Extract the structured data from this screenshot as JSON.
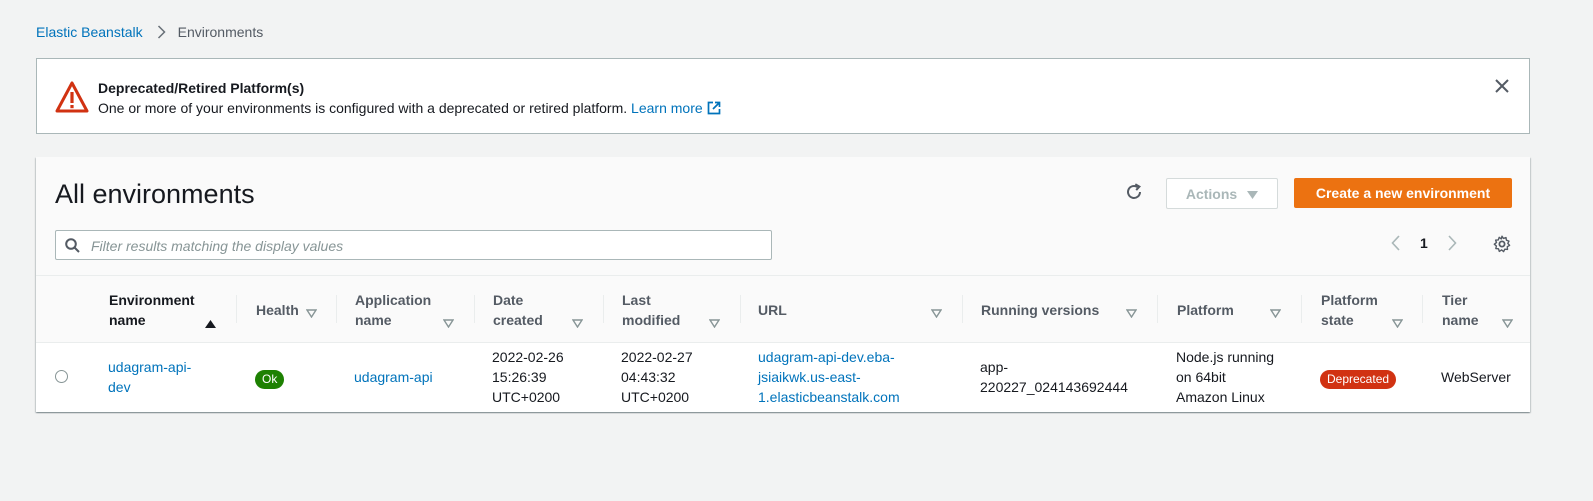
{
  "breadcrumb": {
    "items": [
      "Elastic Beanstalk",
      "Environments"
    ]
  },
  "alert": {
    "title": "Deprecated/Retired Platform(s)",
    "message": "One or more of your environments is configured with a deprecated or retired platform.",
    "link_label": "Learn more",
    "icon": "warning-triangle-icon",
    "color": "#d13212"
  },
  "panel": {
    "title": "All environments",
    "actions_label": "Actions",
    "create_label": "Create a new environment",
    "filter_placeholder": "Filter results matching the display values",
    "page_number": "1"
  },
  "table": {
    "columns": [
      {
        "line1": "Environment",
        "line2": "name",
        "sort": "asc"
      },
      {
        "line1": "Health",
        "line2": "",
        "sort": "filter"
      },
      {
        "line1": "Application",
        "line2": "name",
        "sort": "filter"
      },
      {
        "line1": "Date",
        "line2": "created",
        "sort": "filter"
      },
      {
        "line1": "Last",
        "line2": "modified",
        "sort": "filter"
      },
      {
        "line1": "URL",
        "line2": "",
        "sort": "filter"
      },
      {
        "line1": "Running versions",
        "line2": "",
        "sort": "filter"
      },
      {
        "line1": "Platform",
        "line2": "",
        "sort": "filter"
      },
      {
        "line1": "Platform",
        "line2": "state",
        "sort": "filter"
      },
      {
        "line1": "Tier",
        "line2": "name",
        "sort": "filter"
      }
    ],
    "rows": [
      {
        "env_name": [
          "udagram-api-",
          "dev"
        ],
        "health": "Ok",
        "app_name": "udagram-api",
        "date_created": [
          "2022-02-26",
          "15:26:39",
          "UTC+0200"
        ],
        "last_modified": [
          "2022-02-27",
          "04:43:32",
          "UTC+0200"
        ],
        "url": [
          "udagram-api-dev.eba-",
          "jsiaikwk.us-east-",
          "1.elasticbeanstalk.com"
        ],
        "running_versions": [
          "app-",
          "220227_024143692444"
        ],
        "platform": [
          "Node.js running",
          "on 64bit",
          "Amazon Linux"
        ],
        "platform_state": "Deprecated",
        "tier_name": "WebServer"
      }
    ]
  },
  "colors": {
    "accent": "#ec7211",
    "link": "#0073bb",
    "ok": "#1d8102",
    "deprecated": "#d13212"
  }
}
